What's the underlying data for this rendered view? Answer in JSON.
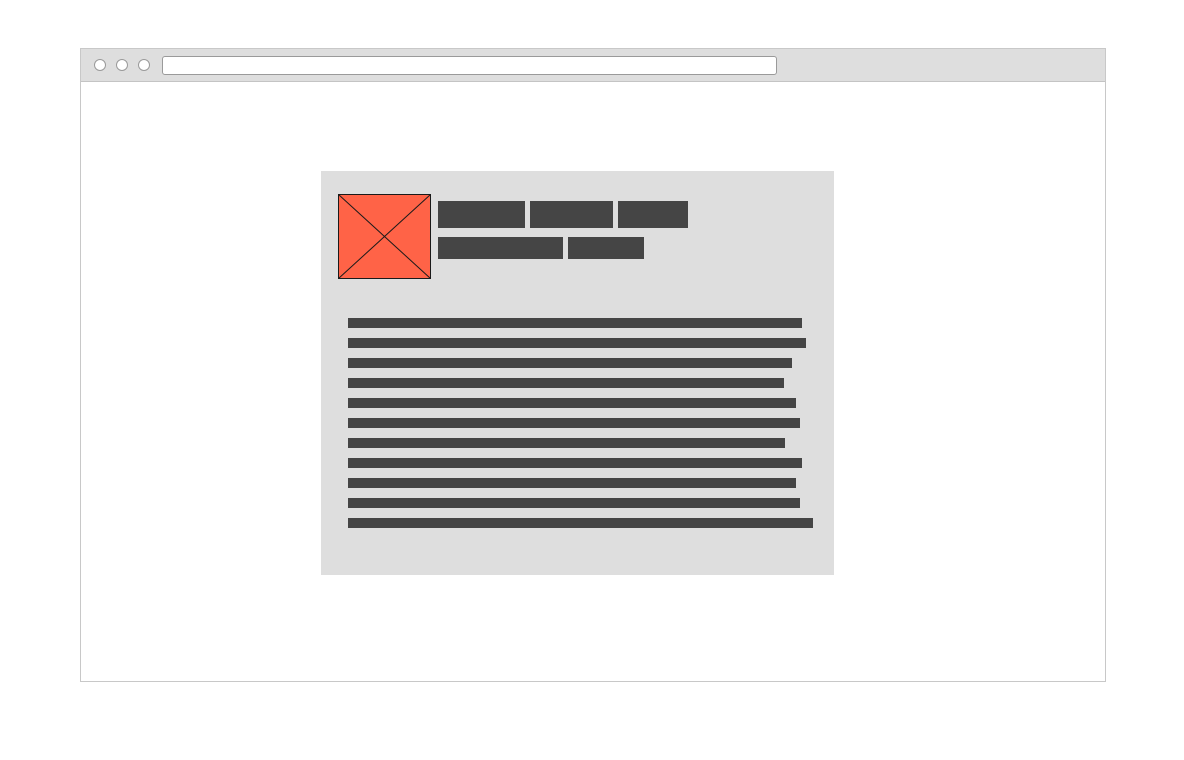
{
  "window": {
    "controls": [
      "close-button",
      "minimize-button",
      "maximize-button"
    ],
    "address_bar_value": ""
  },
  "colors": {
    "chrome": "#dedede",
    "card_background": "#dedede",
    "text_placeholder": "#454545",
    "image_placeholder": "#ff6347"
  },
  "card": {
    "image_placeholder_icon": "image-placeholder-icon",
    "title_blocks_row1": 3,
    "title_blocks_row2": 2,
    "body_line_count": 11
  }
}
